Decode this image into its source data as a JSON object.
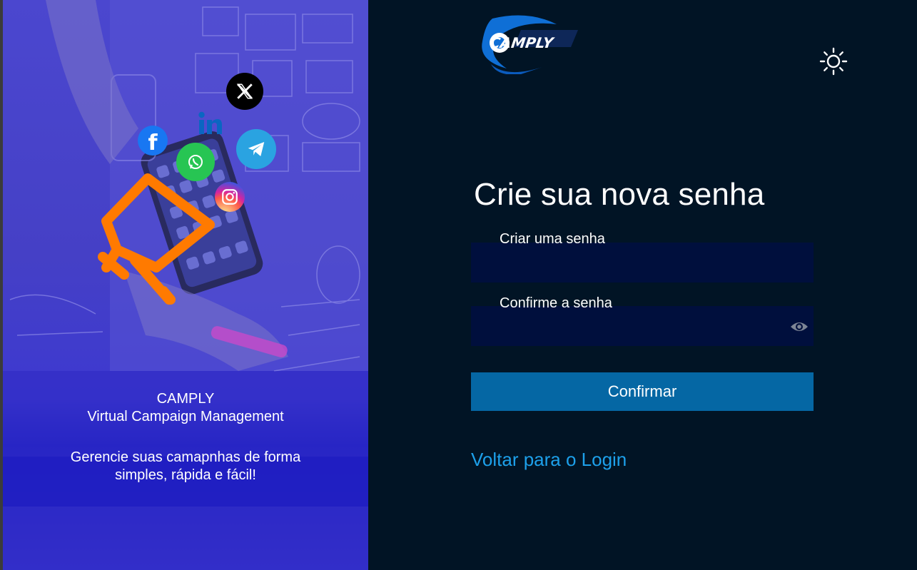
{
  "hero": {
    "brand_line1": "CAMPLY",
    "brand_line2": "Virtual Campaign Management",
    "tagline_line1": "Gerencie suas camapnhas de forma",
    "tagline_line2": "simples, rápida e fácil!",
    "illustration_icon": "megaphone-icon",
    "social_icons": [
      "x-icon",
      "linkedin-icon",
      "facebook-icon",
      "whatsapp-icon",
      "telegram-icon",
      "instagram-icon"
    ],
    "accent_color": "#ff7a00",
    "overlay_color": "#4540c6"
  },
  "logo": {
    "text": "CAMPLY"
  },
  "theme_toggle": {
    "icon": "sun-icon"
  },
  "form": {
    "title": "Crie sua nova senha",
    "password_label": "Criar uma senha",
    "confirm_label": "Confirme a senha",
    "password_value": "",
    "confirm_value": "",
    "toggle_visibility_icon": "eye-icon",
    "submit_label": "Confirmar",
    "back_link": "Voltar para o Login"
  },
  "colors": {
    "background": "#011425",
    "field_background": "#000f3d",
    "button": "#0567a4",
    "link": "#1da0ea"
  }
}
